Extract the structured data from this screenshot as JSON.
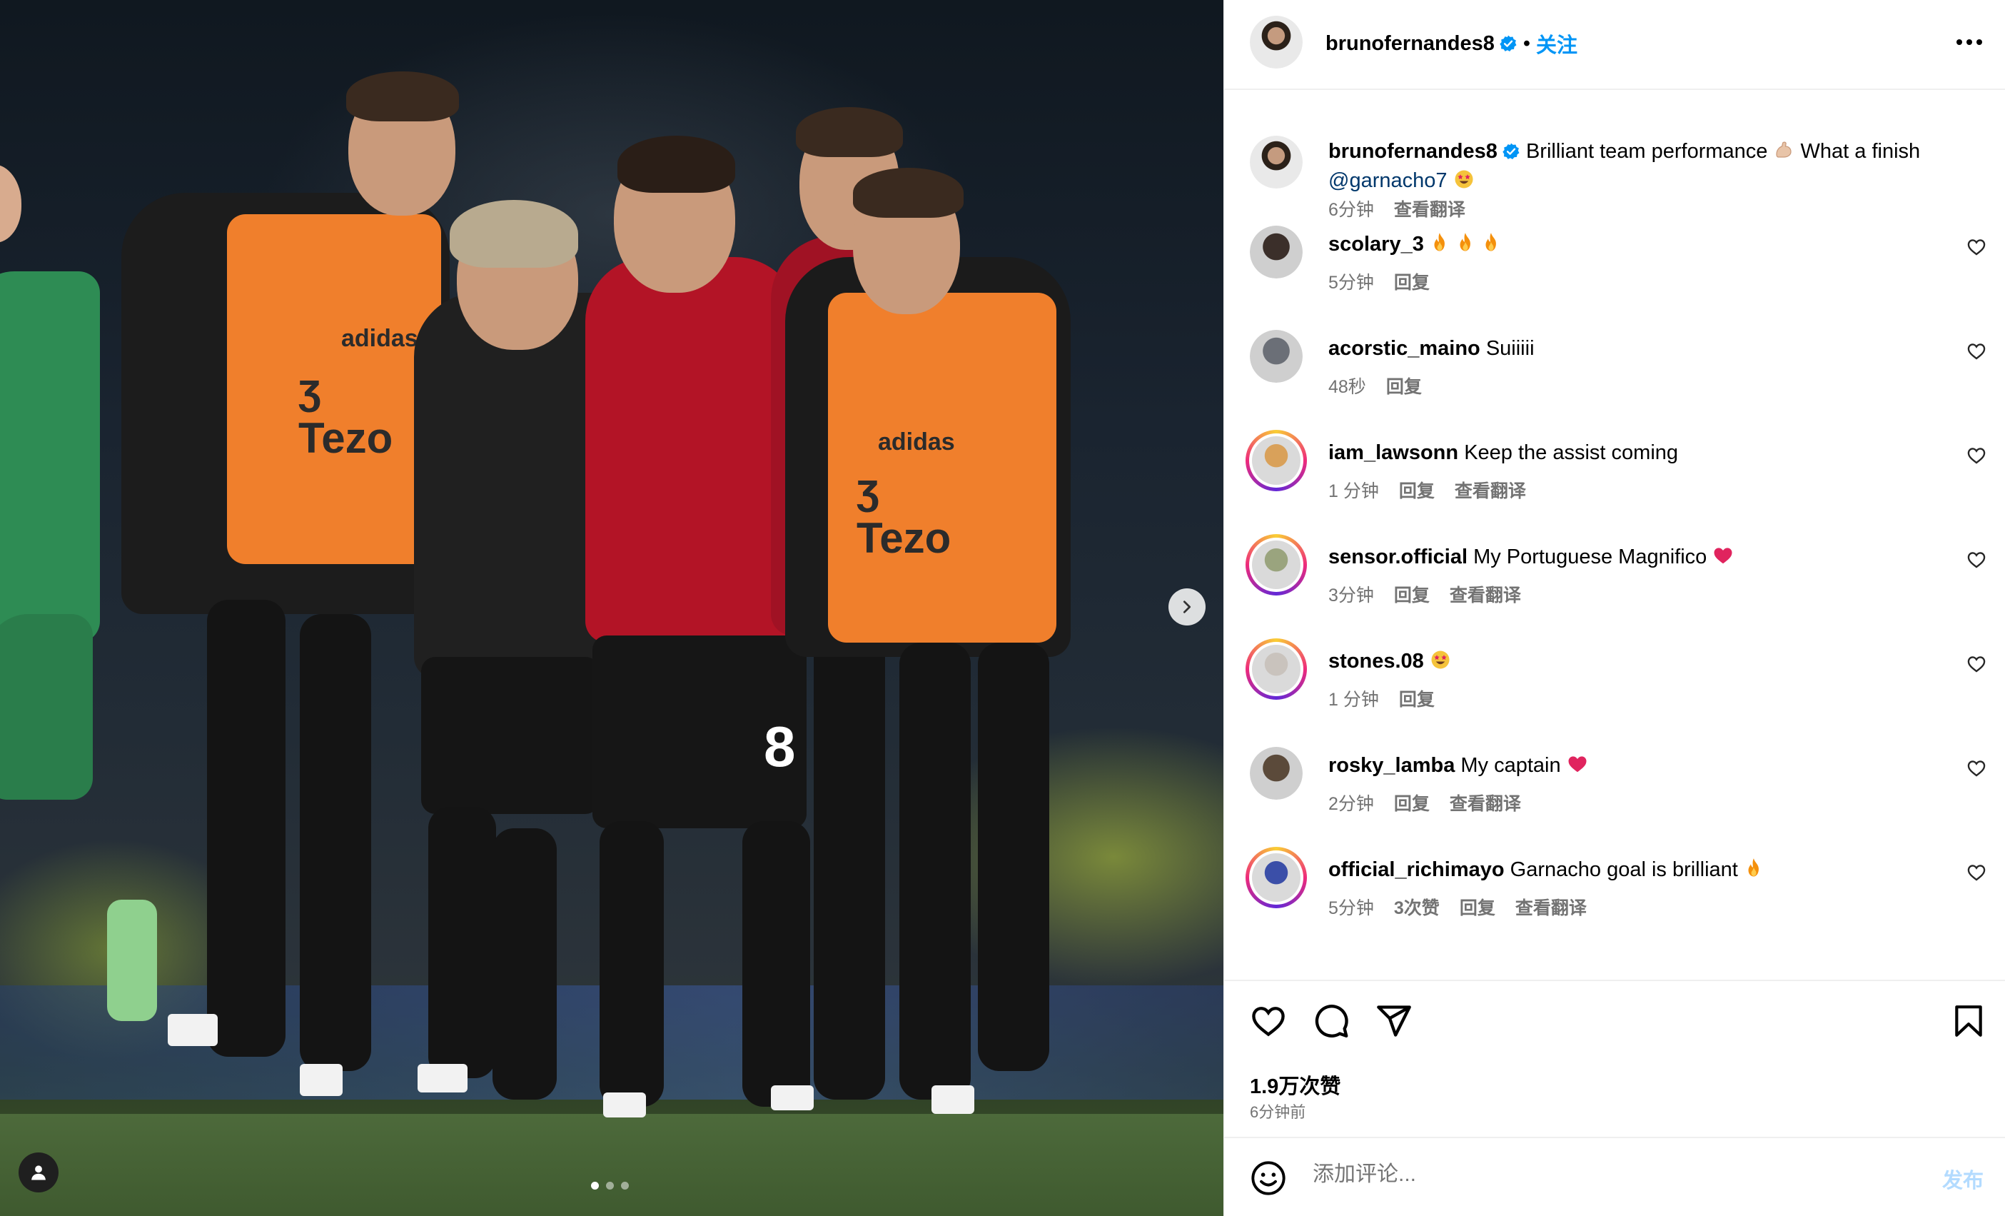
{
  "photo": {
    "next_label": "›",
    "carousel_dots": [
      true,
      false,
      false
    ]
  },
  "header": {
    "username": "brunofernandes8",
    "separator": "•",
    "follow_label": "关注",
    "more_label": "•••"
  },
  "caption": {
    "username": "brunofernandes8",
    "text_part1": "Brilliant team performance",
    "text_part2": "What a finish",
    "mention": "@garnacho7",
    "time": "6分钟",
    "translate": "查看翻译"
  },
  "comments": [
    {
      "username": "scolary_3",
      "text": "",
      "emojis": [
        "fire",
        "fire",
        "fire"
      ],
      "time": "5分钟",
      "likes": "",
      "reply": "回复",
      "translate": "",
      "story_ring": false,
      "avatar_color": "#3b2f2a"
    },
    {
      "username": "acorstic_maino",
      "text": "Suiiiii",
      "emojis": [],
      "time": "48秒",
      "likes": "",
      "reply": "回复",
      "translate": "",
      "story_ring": false,
      "avatar_color": "#6b6f77"
    },
    {
      "username": "iam_lawsonn",
      "text": "Keep the assist coming",
      "emojis": [],
      "time": "1 分钟",
      "likes": "",
      "reply": "回复",
      "translate": "查看翻译",
      "story_ring": true,
      "avatar_color": "#d9a15a"
    },
    {
      "username": "sensor.official",
      "text": "My Portuguese Magnifico",
      "emojis": [
        "heart"
      ],
      "time": "3分钟",
      "likes": "",
      "reply": "回复",
      "translate": "查看翻译",
      "story_ring": true,
      "avatar_color": "#9aa47e"
    },
    {
      "username": "stones.08",
      "text": "",
      "emojis": [
        "starstruck"
      ],
      "time": "1 分钟",
      "likes": "",
      "reply": "回复",
      "translate": "",
      "story_ring": true,
      "avatar_color": "#c9c3bd"
    },
    {
      "username": "rosky_lamba",
      "text": "My captain",
      "emojis": [
        "heart"
      ],
      "time": "2分钟",
      "likes": "",
      "reply": "回复",
      "translate": "查看翻译",
      "story_ring": false,
      "avatar_color": "#5b4a3a"
    },
    {
      "username": "official_richimayo",
      "text": "Garnacho goal is brilliant",
      "emojis": [
        "fire"
      ],
      "time": "5分钟",
      "likes": "3次赞",
      "reply": "回复",
      "translate": "查看翻译",
      "story_ring": true,
      "avatar_color": "#3b4fa8"
    }
  ],
  "actions": {
    "likes_count": "1.9万次赞",
    "posted_ago": "6分钟前"
  },
  "add_comment": {
    "placeholder": "添加评论...",
    "post_label": "发布"
  },
  "colors": {
    "accent": "#0095f6",
    "verified": "#0095f6",
    "muted": "#737373",
    "bib_orange": "#f07f2c",
    "kit_red": "#c8102e"
  },
  "icons": {
    "verified": "verified-badge-icon",
    "more": "more-options-icon",
    "like": "heart-icon",
    "comment": "comment-icon",
    "share": "share-icon",
    "save": "bookmark-icon",
    "emoji": "emoji-icon",
    "next": "chevron-right-icon",
    "user": "user-tag-icon"
  }
}
